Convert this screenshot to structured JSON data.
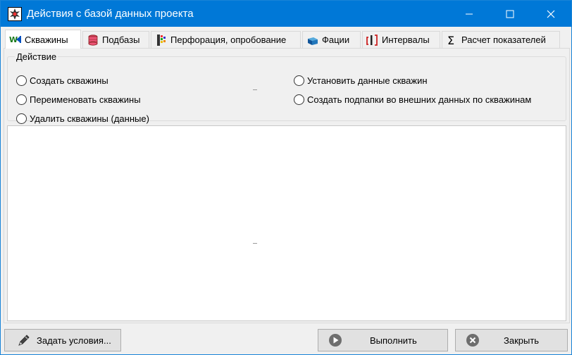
{
  "window": {
    "title": "Действия с базой данных проекта",
    "icon": "app-gear-icon",
    "accent": "#0078d7"
  },
  "tabs": [
    {
      "label": "Скважины",
      "icon": "wells-icon",
      "active": true
    },
    {
      "label": "Подбазы",
      "icon": "database-icon",
      "active": false
    },
    {
      "label": "Перфорация, опробование",
      "icon": "perforation-icon",
      "active": false
    },
    {
      "label": "Фации",
      "icon": "cube-icon",
      "active": false
    },
    {
      "label": "Интервалы",
      "icon": "intervals-icon",
      "active": false
    },
    {
      "label": "Расчет показателей",
      "icon": "sigma-icon",
      "active": false
    }
  ],
  "action_group": {
    "legend": "Действие",
    "options": [
      {
        "label": "Создать скважины",
        "selected": false
      },
      {
        "label": "Переименовать скважины",
        "selected": false
      },
      {
        "label": "Удалить скважины (данные)",
        "selected": false
      },
      {
        "label": "Установить данные скважин",
        "selected": false
      },
      {
        "label": "Создать подпапки во внешних данных по скважинам",
        "selected": false
      }
    ]
  },
  "footer": {
    "conditions_label": "Задать условия...",
    "run_label": "Выполнить",
    "close_label": "Закрыть"
  }
}
